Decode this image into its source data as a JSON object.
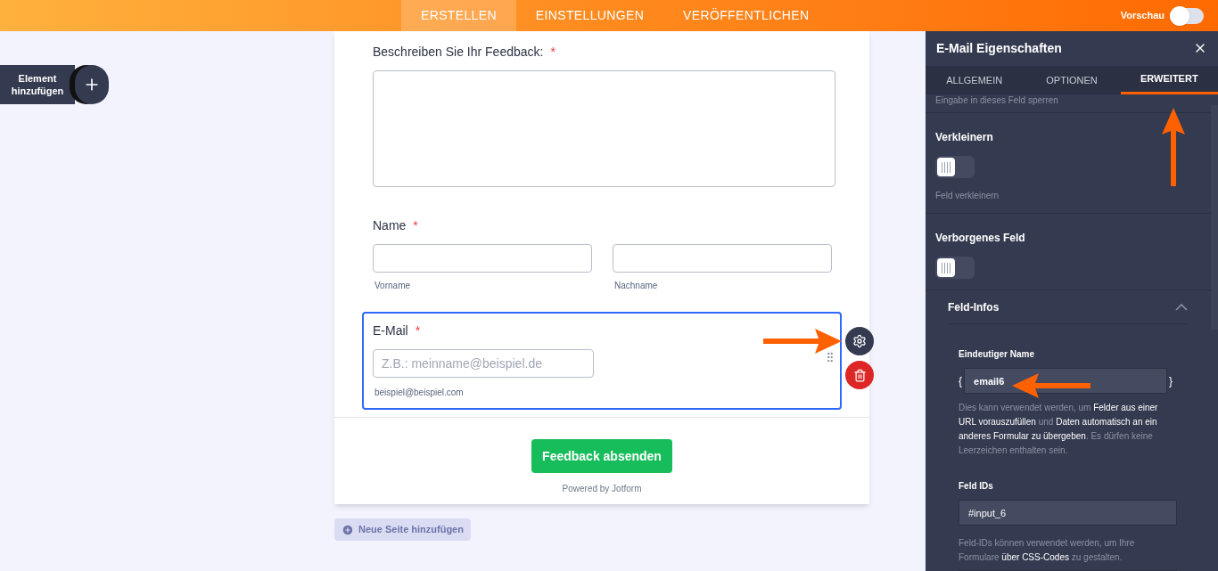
{
  "top_bar": {
    "tabs": [
      {
        "label": "ERSTELLEN",
        "selected": true
      },
      {
        "label": "EINSTELLUNGEN",
        "selected": false
      },
      {
        "label": "VERÖFFENTLICHEN",
        "selected": false
      }
    ],
    "preview": {
      "label": "Vorschau",
      "on": false
    }
  },
  "add_element": {
    "label": "Element hinzufügen"
  },
  "form": {
    "fields": [
      {
        "kind": "textarea",
        "label": "Beschreiben Sie Ihr Feedback:",
        "marker": "*",
        "selected": false
      },
      {
        "kind": "name",
        "label": "Name",
        "marker": "*",
        "selected": false,
        "sublabels": [
          "Vorname",
          "Nachname"
        ]
      },
      {
        "kind": "email",
        "label": "E-Mail",
        "marker": "*",
        "selected": true,
        "placeholder": "Z.B.: meinname@beispiel.de",
        "sublabel": "beispiel@beispiel.com"
      }
    ],
    "submit": "Feedback absenden",
    "powered_by": "Powered by Jotform"
  },
  "add_page": "Neue Seite hinzufügen",
  "panel": {
    "title": "E-Mail Eigenschaften",
    "tabs": [
      {
        "label": "ALLGEMEIN",
        "selected": false
      },
      {
        "label": "OPTIONEN",
        "selected": false
      },
      {
        "label": "ERWEITERT",
        "selected": true
      }
    ],
    "cut_text": "Eingabe in dieses Feld sperren",
    "settings": [
      {
        "title": "Verkleinern",
        "on": false,
        "hint": "Feld verkleinern"
      },
      {
        "title": "Verborgenes Feld",
        "on": false
      }
    ],
    "section": {
      "title": "Feld-Infos",
      "expanded": true,
      "unique_name": {
        "label": "Eindeutiger Name",
        "open": "{",
        "value": "email6",
        "close": "}",
        "description": "Dies kann verwendet werden, um **Felder aus einer URL vorauszufüllen** und **Daten automatisch an ein anderes Formular zu übergeben**. Es dürfen keine Leerzeichen enthalten sein."
      },
      "field_ids": {
        "label": "Feld IDs",
        "value": "#input_6",
        "description": "Feld-IDs können verwendet werden, um Ihre Formulare **über CSS-Codes** zu gestalten."
      }
    }
  }
}
